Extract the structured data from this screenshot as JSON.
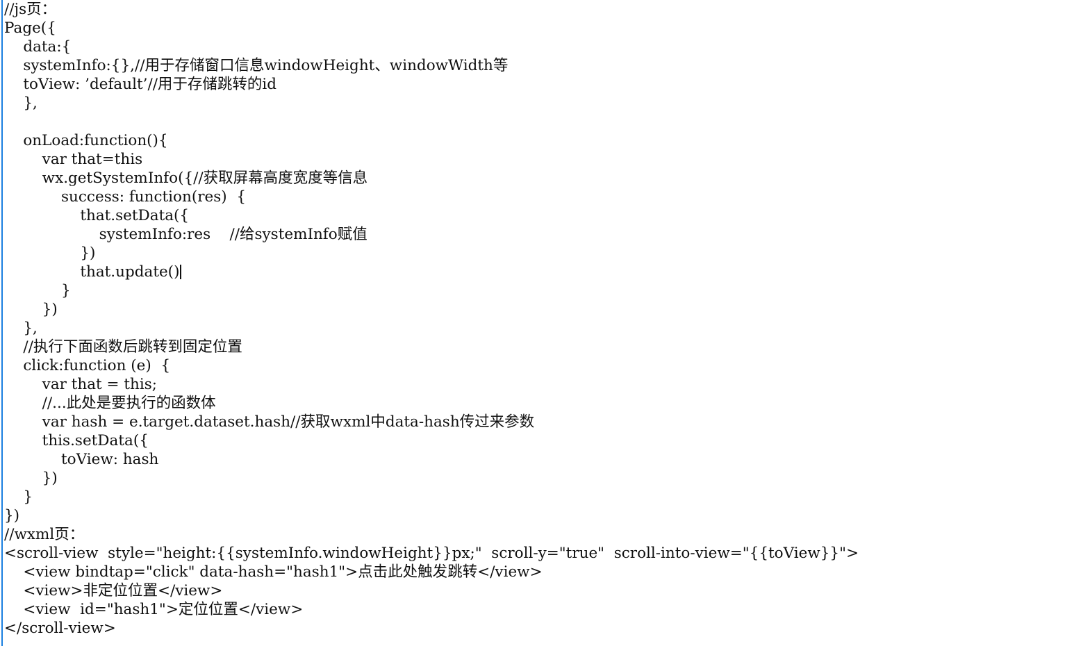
{
  "document": {
    "kind": "code-snippet",
    "language": "javascript-wxml",
    "background_color": "#ffffff",
    "text_color": "#101010",
    "margin_rule_color": "#1a7fe0",
    "caret_after_line_index": 14
  },
  "lines": [
    {
      "id": "l1",
      "text": "//js页："
    },
    {
      "id": "l2",
      "text": "Page({"
    },
    {
      "id": "l3",
      "text": "    data:{"
    },
    {
      "id": "l4",
      "text": "    systemInfo:{},//用于存储窗口信息windowHeight、windowWidth等"
    },
    {
      "id": "l5",
      "text": "    toView: ’default’//用于存储跳转的id"
    },
    {
      "id": "l6",
      "text": "    },"
    },
    {
      "id": "l7",
      "text": ""
    },
    {
      "id": "l8",
      "text": "    onLoad:function(){"
    },
    {
      "id": "l9",
      "text": "        var that=this"
    },
    {
      "id": "l10",
      "text": "        wx.getSystemInfo({//获取屏幕高度宽度等信息"
    },
    {
      "id": "l11",
      "text": "            success: function(res)  {"
    },
    {
      "id": "l12",
      "text": "                that.setData({"
    },
    {
      "id": "l13",
      "text": "                    systemInfo:res    //给systemInfo赋值"
    },
    {
      "id": "l14",
      "text": "                })"
    },
    {
      "id": "l15",
      "text": "                that.update()"
    },
    {
      "id": "l16",
      "text": "            }"
    },
    {
      "id": "l17",
      "text": "        })"
    },
    {
      "id": "l18",
      "text": "    },"
    },
    {
      "id": "l19",
      "text": "    //执行下面函数后跳转到固定位置"
    },
    {
      "id": "l20",
      "text": "    click:function (e)  {"
    },
    {
      "id": "l21",
      "text": "        var that = this;"
    },
    {
      "id": "l22",
      "text": "        //...此处是要执行的函数体"
    },
    {
      "id": "l23",
      "text": "        var hash = e.target.dataset.hash//获取wxml中data-hash传过来参数"
    },
    {
      "id": "l24",
      "text": "        this.setData({"
    },
    {
      "id": "l25",
      "text": "            toView: hash"
    },
    {
      "id": "l26",
      "text": "        })"
    },
    {
      "id": "l27",
      "text": "    }"
    },
    {
      "id": "l28",
      "text": "})"
    },
    {
      "id": "l29",
      "text": "//wxml页："
    },
    {
      "id": "l30",
      "text": "<scroll-view  style=\"height:{{systemInfo.windowHeight}}px;\"  scroll-y=\"true\"  scroll-into-view=\"{{toView}}\">"
    },
    {
      "id": "l31",
      "text": "    <view bindtap=\"click\" data-hash=\"hash1\">点击此处触发跳转</view>"
    },
    {
      "id": "l32",
      "text": "    <view>非定位位置</view>"
    },
    {
      "id": "l33",
      "text": "    <view  id=\"hash1\">定位位置</view>"
    },
    {
      "id": "l34",
      "text": "</scroll-view>"
    }
  ]
}
